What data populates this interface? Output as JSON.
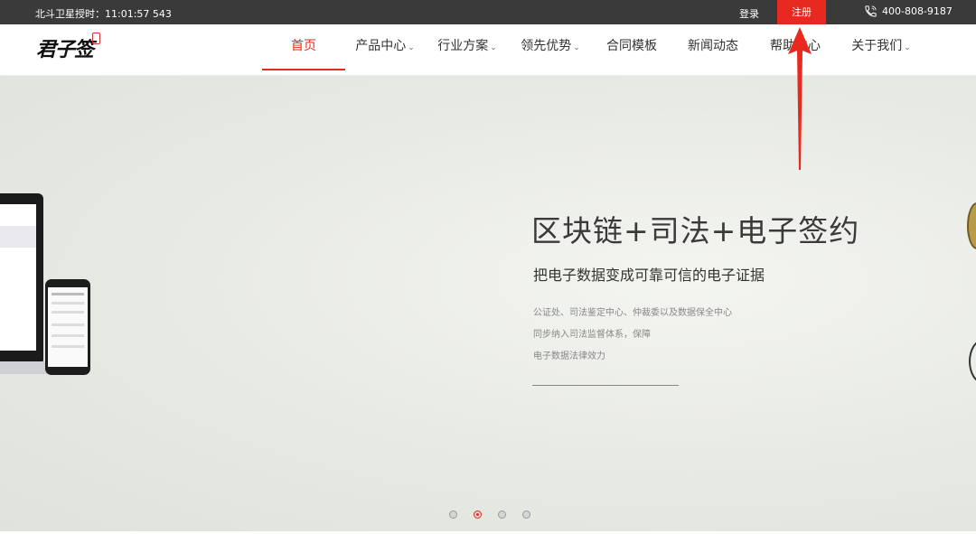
{
  "topbar": {
    "time_text": "北斗卫星授时：11:01:57 543",
    "login": "登录",
    "register": "注册",
    "phone": "400-808-9187"
  },
  "logo": {
    "text": "君子签"
  },
  "nav": {
    "items": [
      {
        "label": "首页",
        "active": true,
        "dropdown": false
      },
      {
        "label": "产品中心",
        "active": false,
        "dropdown": true
      },
      {
        "label": "行业方案",
        "active": false,
        "dropdown": true
      },
      {
        "label": "领先优势",
        "active": false,
        "dropdown": true
      },
      {
        "label": "合同模板",
        "active": false,
        "dropdown": false
      },
      {
        "label": "新闻动态",
        "active": false,
        "dropdown": false
      },
      {
        "label": "帮助中心",
        "active": false,
        "dropdown": false
      },
      {
        "label": "关于我们",
        "active": false,
        "dropdown": true
      }
    ]
  },
  "banner": {
    "headline": "区块链+司法+电子签约",
    "subheadline": "把电子数据变成可靠可信的电子证据",
    "desc_line1": "公证处、司法鉴定中心、仲裁委以及数据保全中心",
    "desc_line2": "同步纳入司法监督体系，保障",
    "desc_line3": "电子数据法律效力",
    "carousel_active_index": 1,
    "carousel_count": 4
  },
  "icons": {
    "phone": "phone-icon",
    "caret": "chevron-down-icon",
    "annotation": "red-arrow-annotation"
  },
  "colors": {
    "accent": "#e8291f",
    "topbar_bg": "#3a3a3a"
  }
}
